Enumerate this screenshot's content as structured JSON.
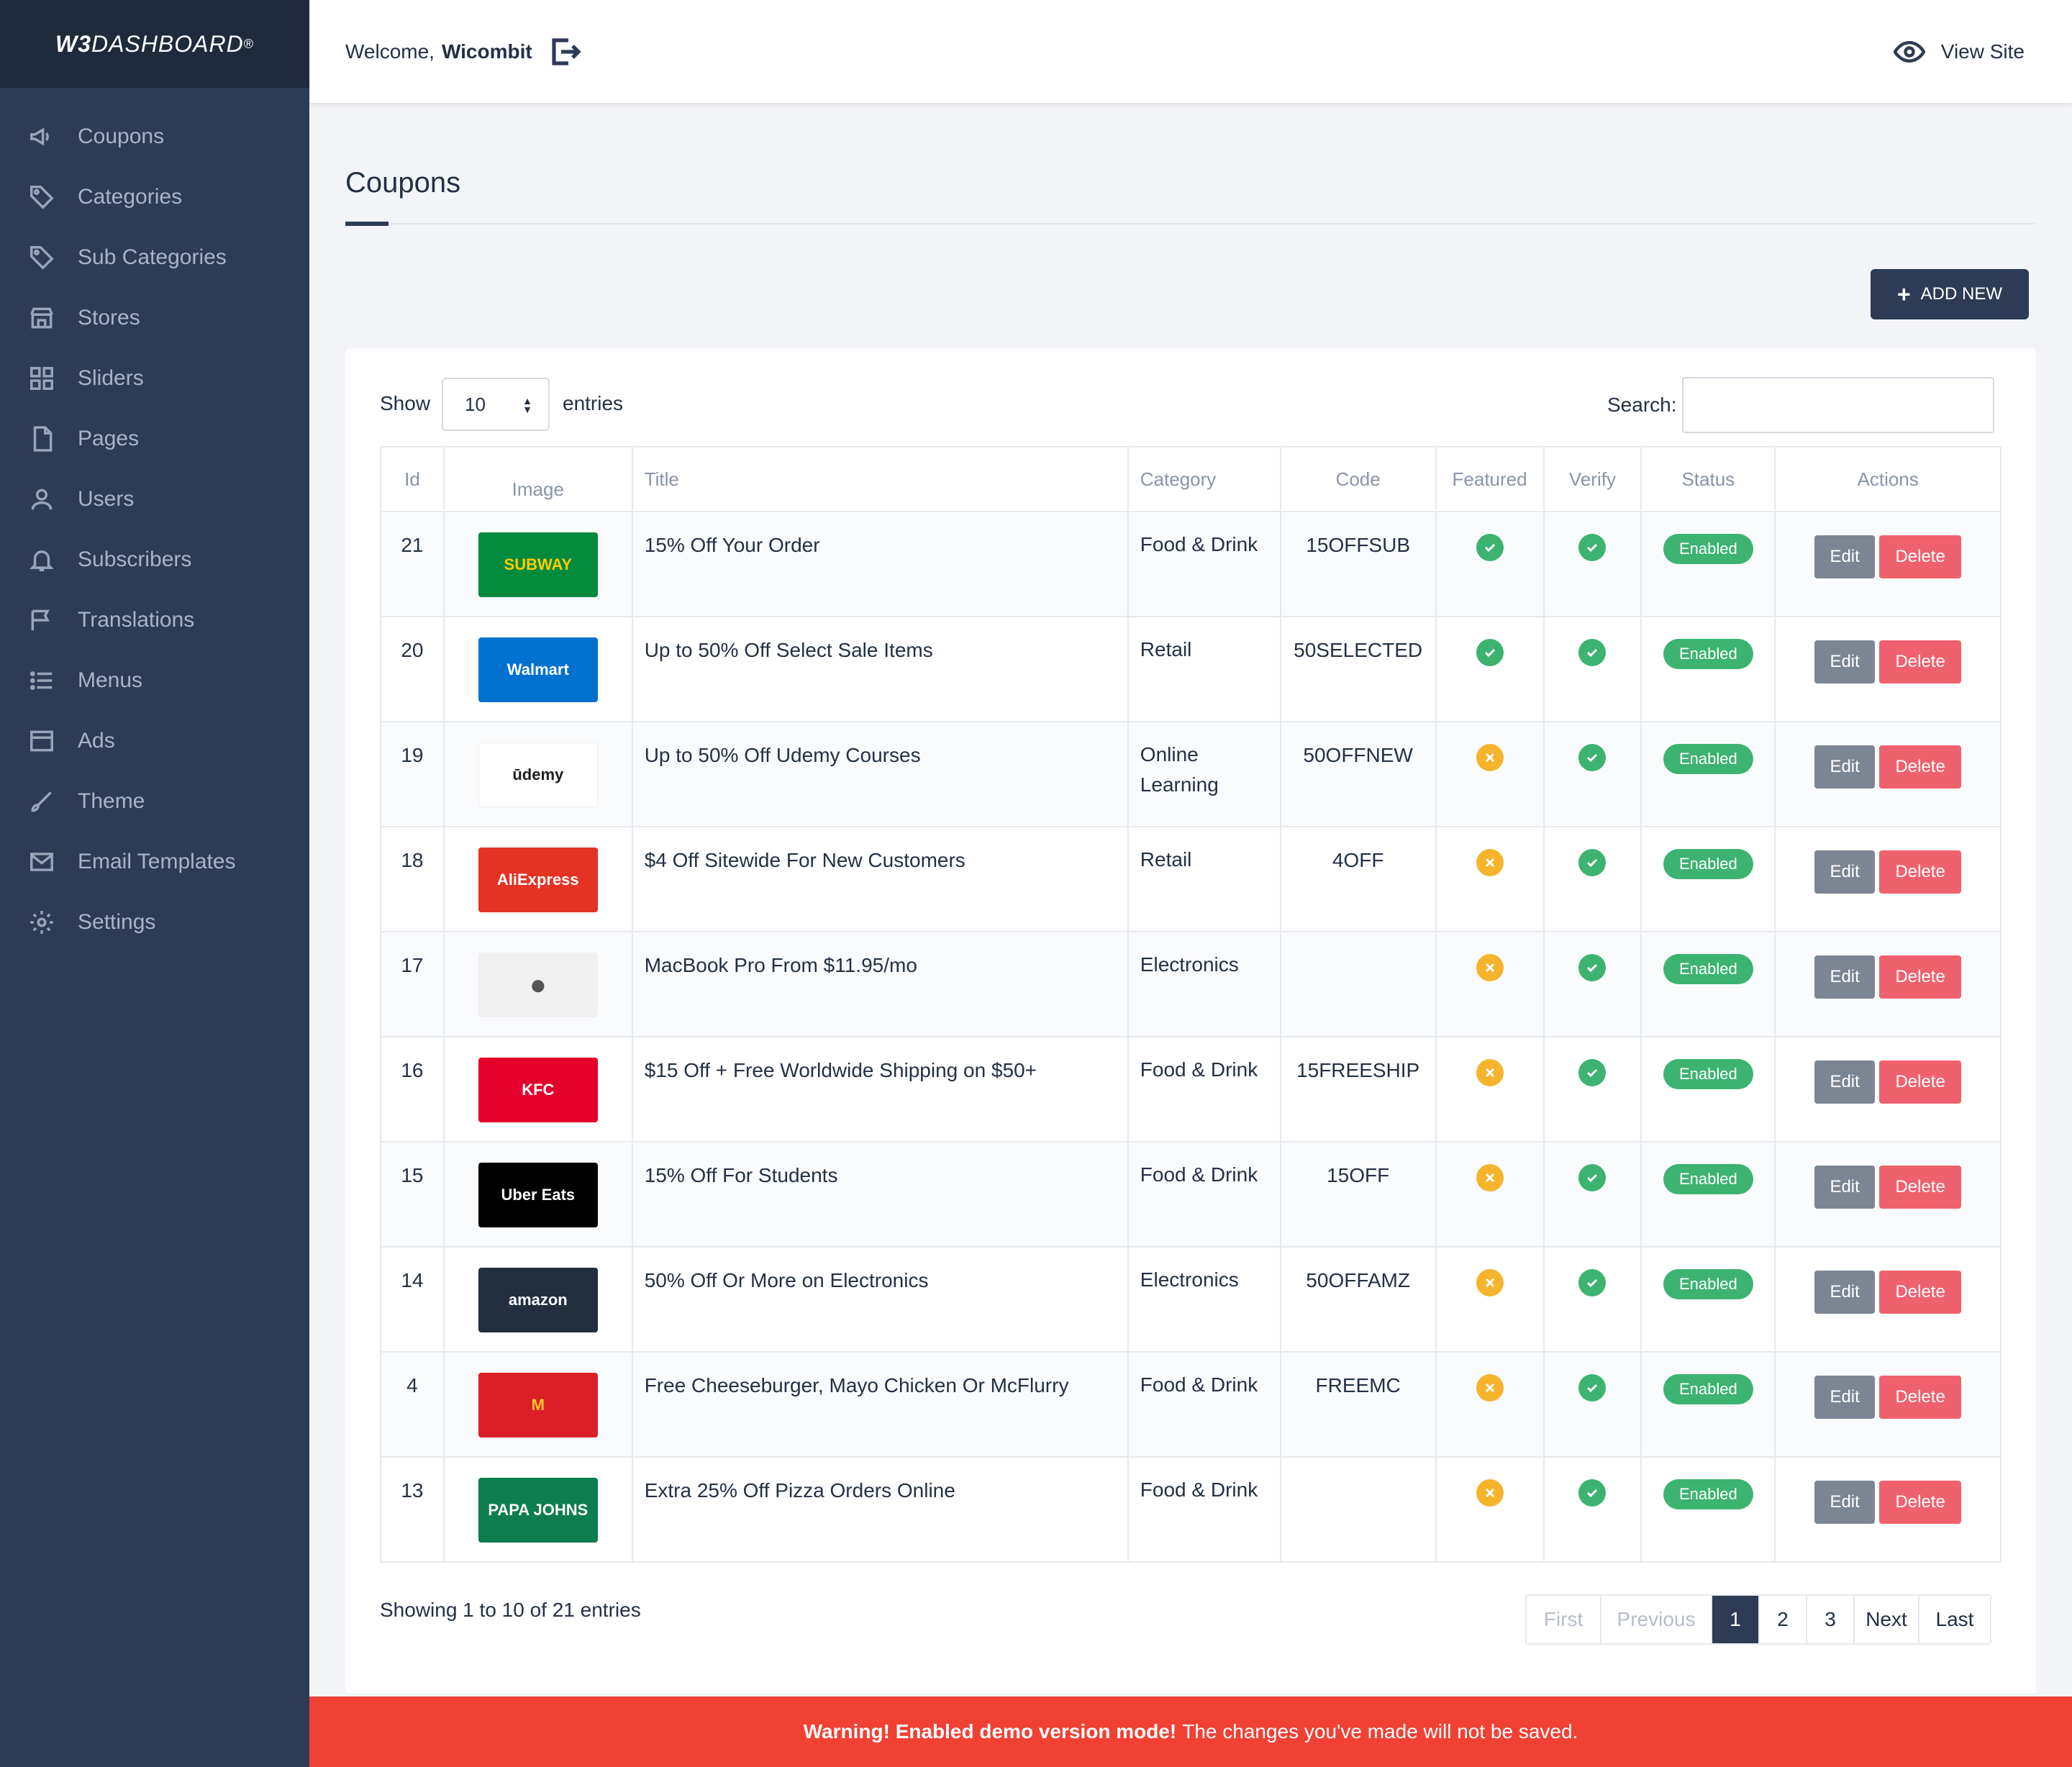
{
  "brand": {
    "logo_mark": "W3",
    "logo_text": "DASHBOARD",
    "logo_reg": "®"
  },
  "sidebar": {
    "items": [
      {
        "label": "Coupons",
        "icon": "megaphone-icon"
      },
      {
        "label": "Categories",
        "icon": "tag-icon"
      },
      {
        "label": "Sub Categories",
        "icon": "tag-icon"
      },
      {
        "label": "Stores",
        "icon": "store-icon"
      },
      {
        "label": "Sliders",
        "icon": "grid-icon"
      },
      {
        "label": "Pages",
        "icon": "page-icon"
      },
      {
        "label": "Users",
        "icon": "user-icon"
      },
      {
        "label": "Subscribers",
        "icon": "bell-icon"
      },
      {
        "label": "Translations",
        "icon": "flag-icon"
      },
      {
        "label": "Menus",
        "icon": "list-icon"
      },
      {
        "label": "Ads",
        "icon": "window-icon"
      },
      {
        "label": "Theme",
        "icon": "brush-icon"
      },
      {
        "label": "Email Templates",
        "icon": "mail-icon"
      },
      {
        "label": "Settings",
        "icon": "gear-icon"
      }
    ]
  },
  "header": {
    "welcome_prefix": "Welcome,",
    "username": "Wicombit",
    "view_site": "View Site"
  },
  "page": {
    "title": "Coupons",
    "add_new": "ADD NEW"
  },
  "table_controls": {
    "show_label": "Show",
    "entries_value": "10",
    "entries_label": "entries",
    "search_label": "Search:"
  },
  "table": {
    "columns": [
      "Id",
      "Image",
      "Title",
      "Category",
      "Code",
      "Featured",
      "Verify",
      "Status",
      "Actions"
    ],
    "rows": [
      {
        "id": "21",
        "logo": "SUBWAY",
        "logo_bg": "#028a3d",
        "logo_fg": "#ffcc00",
        "title": "15% Off Your Order",
        "category": "Food & Drink",
        "code": "15OFFSUB",
        "featured": true,
        "verify": true,
        "status": "Enabled"
      },
      {
        "id": "20",
        "logo": "Walmart",
        "logo_bg": "#0071ce",
        "logo_fg": "#ffffff",
        "title": "Up to 50% Off Select Sale Items",
        "category": "Retail",
        "code": "50SELECTED",
        "featured": true,
        "verify": true,
        "status": "Enabled"
      },
      {
        "id": "19",
        "logo": "ūdemy",
        "logo_bg": "#ffffff",
        "logo_fg": "#1c1d1f",
        "title": "Up to 50% Off Udemy Courses",
        "category": "Online Learning",
        "code": "50OFFNEW",
        "featured": false,
        "verify": true,
        "status": "Enabled"
      },
      {
        "id": "18",
        "logo": "AliExpress",
        "logo_bg": "#e43225",
        "logo_fg": "#ffffff",
        "title": "$4 Off Sitewide For New Customers",
        "category": "Retail",
        "code": "4OFF",
        "featured": false,
        "verify": true,
        "status": "Enabled"
      },
      {
        "id": "17",
        "logo": "",
        "logo_bg": "#f0f0f0",
        "logo_fg": "#555555",
        "title": "MacBook Pro From $11.95/mo",
        "category": "Electronics",
        "code": "",
        "featured": false,
        "verify": true,
        "status": "Enabled"
      },
      {
        "id": "16",
        "logo": "KFC",
        "logo_bg": "#e4002b",
        "logo_fg": "#ffffff",
        "title": "$15 Off + Free Worldwide Shipping on $50+",
        "category": "Food & Drink",
        "code": "15FREESHIP",
        "featured": false,
        "verify": true,
        "status": "Enabled"
      },
      {
        "id": "15",
        "logo": "Uber Eats",
        "logo_bg": "#000000",
        "logo_fg": "#ffffff",
        "title": "15% Off For Students",
        "category": "Food & Drink",
        "code": "15OFF",
        "featured": false,
        "verify": true,
        "status": "Enabled"
      },
      {
        "id": "14",
        "logo": "amazon",
        "logo_bg": "#232f3e",
        "logo_fg": "#ffffff",
        "title": "50% Off Or More on Electronics",
        "category": "Electronics",
        "code": "50OFFAMZ",
        "featured": false,
        "verify": true,
        "status": "Enabled"
      },
      {
        "id": "4",
        "logo": "M",
        "logo_bg": "#db1f26",
        "logo_fg": "#ffc72c",
        "title": "Free Cheeseburger, Mayo Chicken Or McFlurry",
        "category": "Food & Drink",
        "code": "FREEMC",
        "featured": false,
        "verify": true,
        "status": "Enabled"
      },
      {
        "id": "13",
        "logo": "PAPA JOHNS",
        "logo_bg": "#0c7d4f",
        "logo_fg": "#ffffff",
        "title": "Extra 25% Off Pizza Orders Online",
        "category": "Food & Drink",
        "code": "",
        "featured": false,
        "verify": true,
        "status": "Enabled"
      }
    ],
    "edit_label": "Edit",
    "delete_label": "Delete"
  },
  "footer": {
    "showing": "Showing 1 to 10 of 21 entries",
    "pagination": [
      {
        "label": "First",
        "state": "disabled"
      },
      {
        "label": "Previous",
        "state": "disabled"
      },
      {
        "label": "1",
        "state": "active"
      },
      {
        "label": "2",
        "state": "normal"
      },
      {
        "label": "3",
        "state": "normal"
      },
      {
        "label": "Next",
        "state": "normal"
      },
      {
        "label": "Last",
        "state": "normal"
      }
    ]
  },
  "warning": {
    "strong": "Warning! Enabled demo version mode!",
    "text": "The changes you've made will not be saved."
  },
  "colors": {
    "sidebar_bg": "#2e3b55",
    "accent": "#2e3b55",
    "success": "#3cb371",
    "warning_dot": "#f6b42c",
    "danger": "#f0616e",
    "banner": "#f04134"
  }
}
